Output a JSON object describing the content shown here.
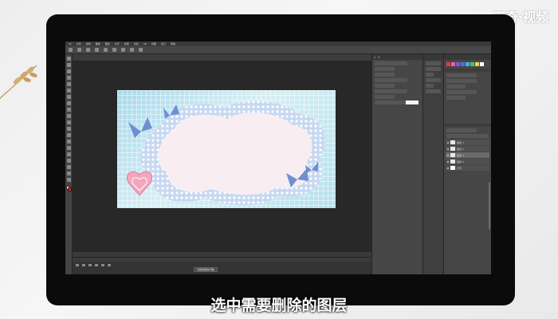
{
  "watermark": "天奇·视频",
  "subtitle": "选中需要删除的图层",
  "colors": {
    "canvas_bg": "#bfe6ee",
    "cloud": "#f8eef1",
    "frame": "#cfe0f3",
    "butterfly": "#6f8fd2",
    "heart": "#f2a7bf",
    "fg_swatch": "#ffffff",
    "bg_swatch": "#e0221b"
  },
  "photoshop": {
    "menu_items": [
      "PS",
      "文件",
      "编辑",
      "图像",
      "图层",
      "文字",
      "选择",
      "滤镜",
      "3D",
      "视图",
      "窗口",
      "帮助"
    ],
    "tools": [
      "move-tool",
      "marquee-tool",
      "lasso-tool",
      "quick-select-tool",
      "crop-tool",
      "eyedropper-tool",
      "healing-tool",
      "brush-tool",
      "stamp-tool",
      "history-brush-tool",
      "eraser-tool",
      "gradient-tool",
      "blur-tool",
      "dodge-tool",
      "pen-tool",
      "type-tool",
      "path-select-tool",
      "shape-tool",
      "hand-tool",
      "zoom-tool"
    ],
    "layers": [
      "图层 1",
      "图层 2",
      "图层 3",
      "图层 4",
      "背景"
    ],
    "timeline_button": "创建视频时间轴"
  }
}
